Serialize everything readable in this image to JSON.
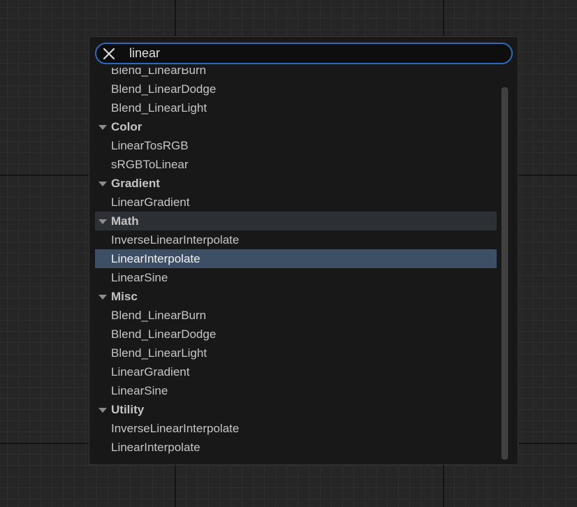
{
  "search": {
    "value": "linear"
  },
  "results": [
    {
      "kind": "item",
      "label": "Blend_LinearBurn"
    },
    {
      "kind": "item",
      "label": "Blend_LinearDodge"
    },
    {
      "kind": "item",
      "label": "Blend_LinearLight"
    },
    {
      "kind": "category",
      "label": "Color"
    },
    {
      "kind": "item",
      "label": "LinearTosRGB"
    },
    {
      "kind": "item",
      "label": "sRGBToLinear"
    },
    {
      "kind": "category",
      "label": "Gradient"
    },
    {
      "kind": "item",
      "label": "LinearGradient"
    },
    {
      "kind": "category",
      "label": "Math",
      "state": "hovered"
    },
    {
      "kind": "item",
      "label": "InverseLinearInterpolate"
    },
    {
      "kind": "item",
      "label": "LinearInterpolate",
      "state": "selected"
    },
    {
      "kind": "item",
      "label": "LinearSine"
    },
    {
      "kind": "category",
      "label": "Misc"
    },
    {
      "kind": "item",
      "label": "Blend_LinearBurn"
    },
    {
      "kind": "item",
      "label": "Blend_LinearDodge"
    },
    {
      "kind": "item",
      "label": "Blend_LinearLight"
    },
    {
      "kind": "item",
      "label": "LinearGradient"
    },
    {
      "kind": "item",
      "label": "LinearSine"
    },
    {
      "kind": "category",
      "label": "Utility"
    },
    {
      "kind": "item",
      "label": "InverseLinearInterpolate"
    },
    {
      "kind": "item",
      "label": "LinearInterpolate"
    }
  ],
  "colors": {
    "accent": "#2b6bbd",
    "selected_row": "#3d4f65",
    "hovered_row": "#2c2f34",
    "panel": "#181818"
  },
  "icons": {
    "clear": "close-icon",
    "category_toggle": "triangle-down-icon"
  }
}
